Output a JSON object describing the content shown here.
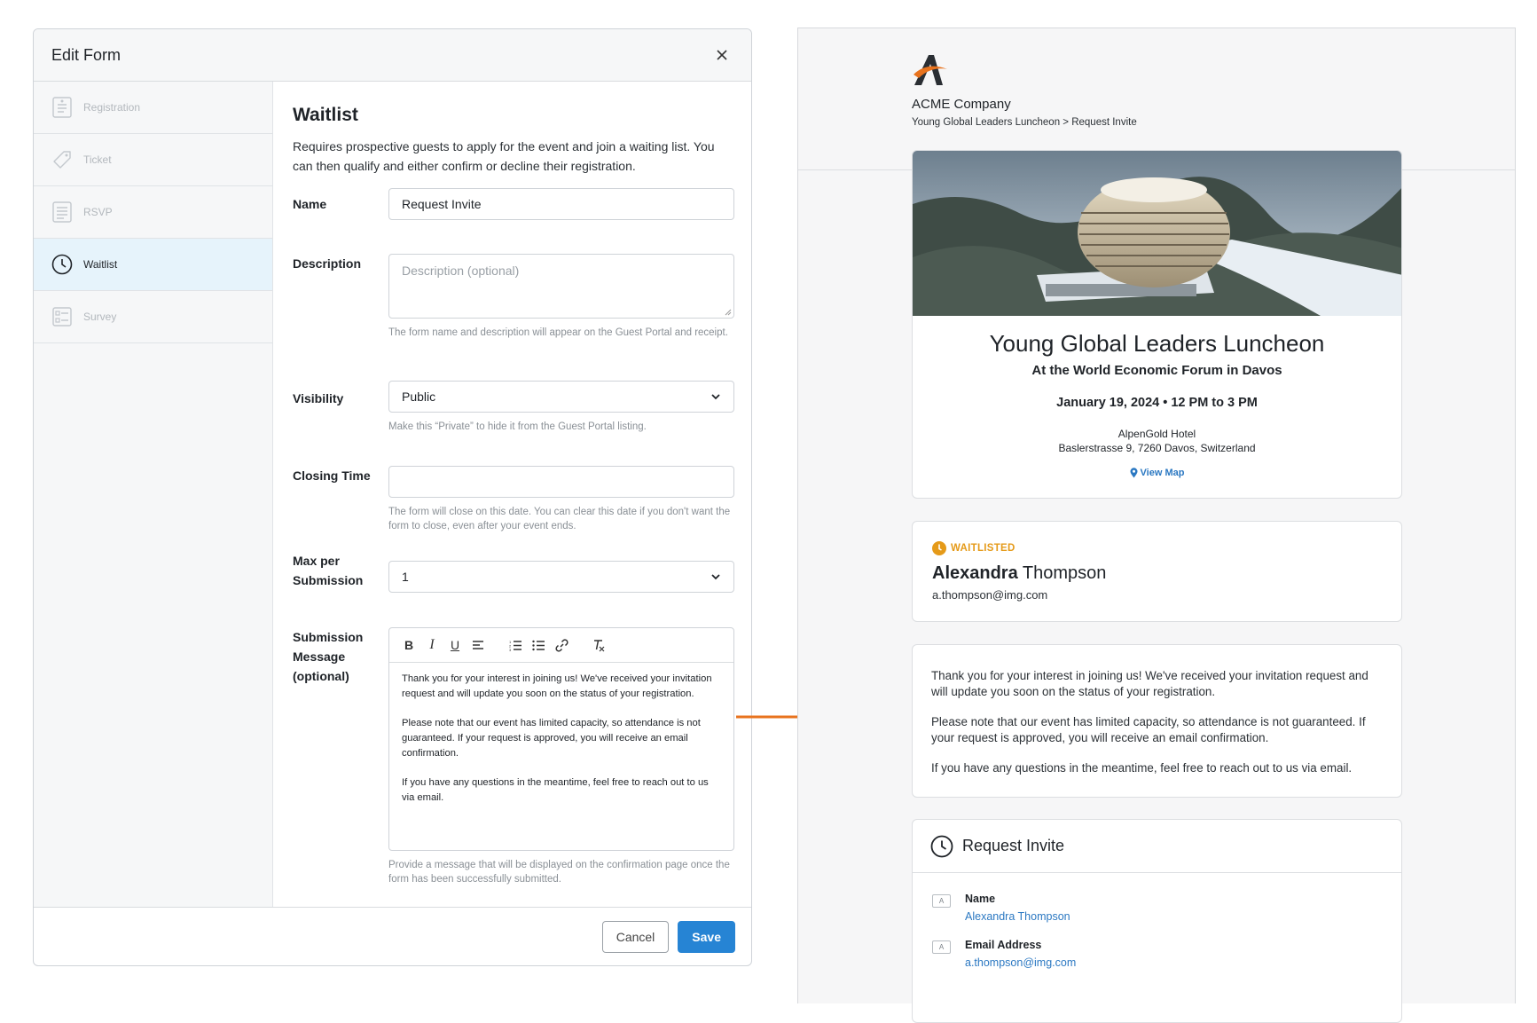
{
  "modal": {
    "title": "Edit Form",
    "sidebar": [
      {
        "label": "Registration",
        "icon": "document-icon"
      },
      {
        "label": "Ticket",
        "icon": "ticket-icon"
      },
      {
        "label": "RSVP",
        "icon": "list-document-icon"
      },
      {
        "label": "Waitlist",
        "icon": "clock-icon"
      },
      {
        "label": "Survey",
        "icon": "checklist-icon"
      }
    ],
    "active_item": "Waitlist",
    "content": {
      "title": "Waitlist",
      "intro": "Requires prospective guests to apply for the event and join a waiting list. You can then qualify and either confirm or decline their registration.",
      "name_label": "Name",
      "name_value": "Request Invite",
      "description_label": "Description",
      "description_placeholder": "Description (optional)",
      "description_help": "The form name and description will appear on the Guest Portal and receipt.",
      "visibility_label": "Visibility",
      "visibility_value": "Public",
      "visibility_help": "Make this “Private” to hide it from the Guest Portal listing.",
      "closing_label": "Closing Time",
      "closing_value": "",
      "closing_help": "The form will close on this date. You can clear this date if you don't want the form to close, even after your event ends.",
      "max_label": "Max per Submission",
      "max_value": "1",
      "message_label": "Submission Message (optional)",
      "message_paragraphs": [
        "Thank you for your interest in joining us! We've received your invitation request and will update you soon on the status of your registration.",
        "Please note that our event has limited capacity, so attendance is not guaranteed. If your request is approved, you will receive an email confirmation.",
        "If you have any questions in the meantime, feel free to reach out to us via email."
      ],
      "message_help": "Provide a message that will be displayed on the confirmation page once the form has been successfully submitted."
    },
    "cancel_label": "Cancel",
    "save_label": "Save"
  },
  "portal": {
    "company": "ACME Company",
    "breadcrumb": "Young Global Leaders Luncheon  >  Request Invite",
    "event": {
      "title": "Young Global Leaders Luncheon",
      "subtitle": "At the World Economic Forum in Davos",
      "date": "January 19, 2024 • 12 PM to 3 PM",
      "venue_name": "AlpenGold Hotel",
      "venue_address": "Baslerstrasse 9, 7260 Davos, Switzerland",
      "map_link": "View Map"
    },
    "status": {
      "badge": "WAITLISTED",
      "first_name": "Alexandra",
      "last_name": "Thompson",
      "email": "a.thompson@img.com"
    },
    "message_paragraphs": [
      "Thank you for your interest in joining us! We've received your invitation request and will update you soon on the status of your registration.",
      "Please note that our event has limited capacity, so attendance is not guaranteed. If your request is approved, you will receive an email confirmation.",
      "If you have any questions in the meantime, feel free to reach out to us via email."
    ],
    "form": {
      "title": "Request Invite",
      "fields": [
        {
          "label": "Name",
          "value": "Alexandra Thompson"
        },
        {
          "label": "Email Address",
          "value": "a.thompson@img.com"
        }
      ]
    }
  },
  "colors": {
    "accent_blue": "#2684d4",
    "arrow_orange": "#e8731e",
    "waitlist_amber": "#e59a19",
    "active_sidebar": "#e6f3fb"
  }
}
